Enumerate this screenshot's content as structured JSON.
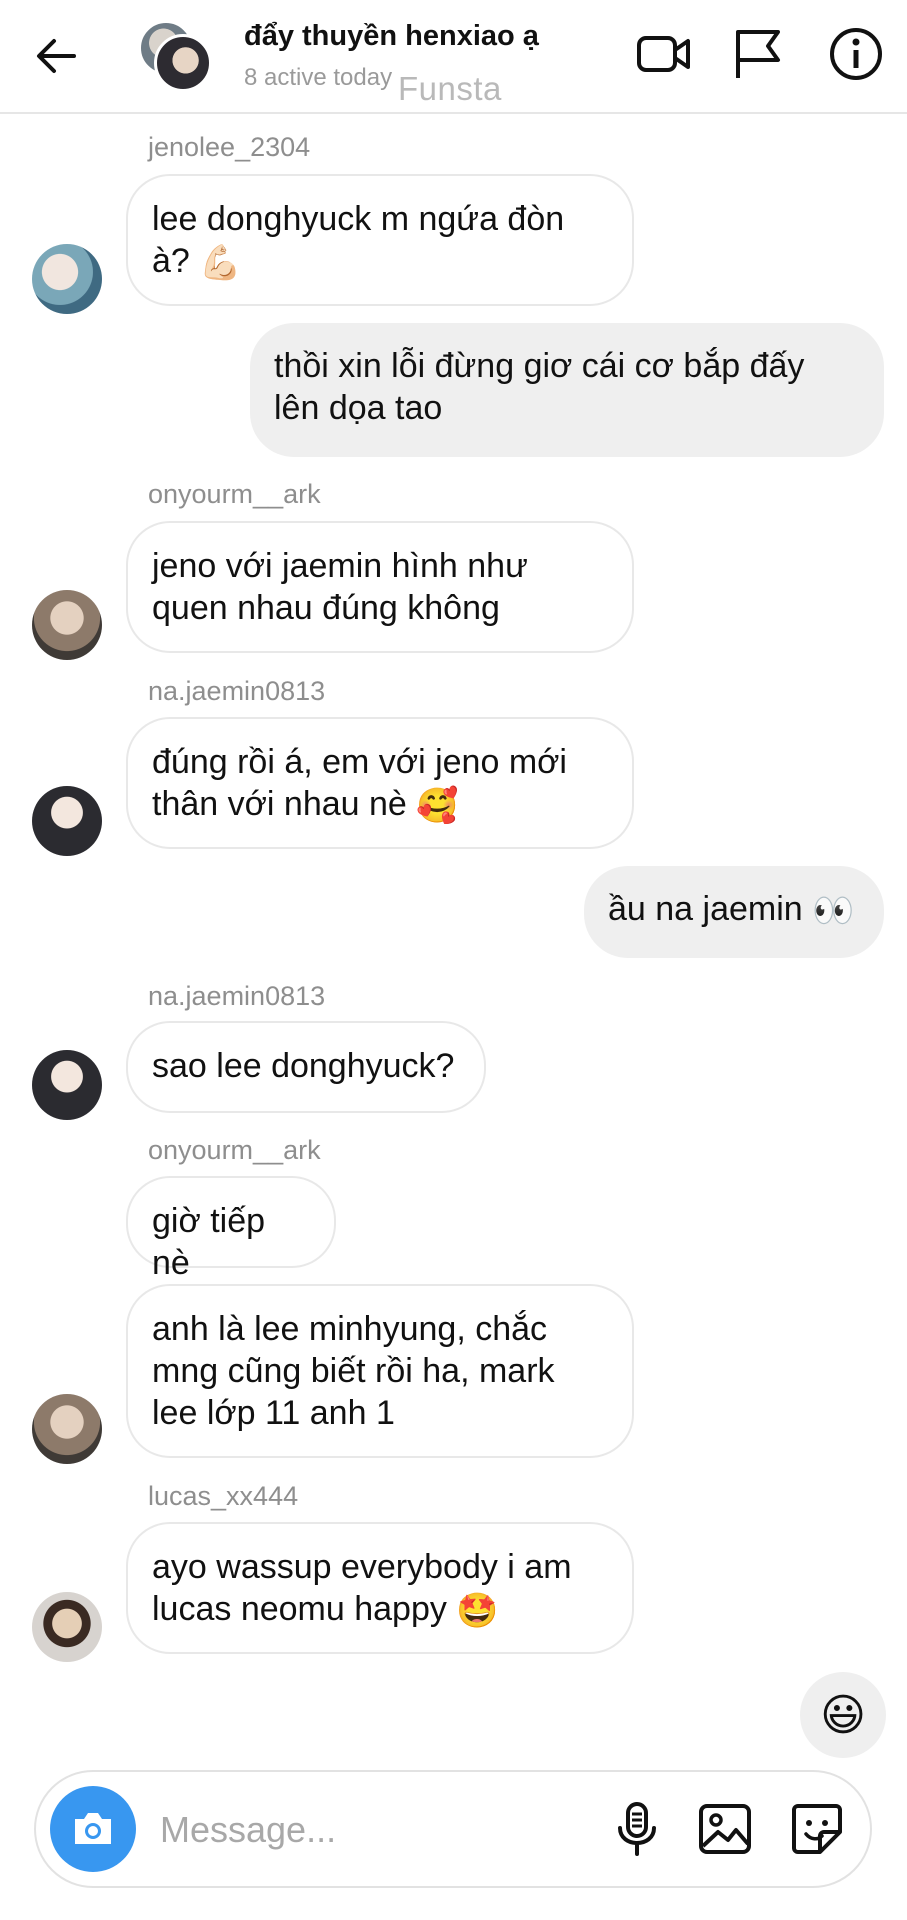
{
  "header": {
    "title": "đẩy thuyền henxiao ạ",
    "subtitle": "8 active today",
    "watermark": "Funsta",
    "icons": [
      "back-arrow-icon",
      "video-camera-icon",
      "flag-icon",
      "info-icon"
    ]
  },
  "messages": [
    {
      "sender": "jenolee_2304",
      "lines": [
        "lee donghyuck m ngứa đòn",
        "à?"
      ],
      "emoji": "💪🏻",
      "direction": "in"
    },
    {
      "lines": [
        "thồi xin lỗi đừng giơ cái cơ bắp đấy",
        "lên dọa tao"
      ],
      "direction": "out"
    },
    {
      "sender": "onyourm__ark",
      "lines": [
        "jeno với jaemin hình như",
        "quen nhau đúng không"
      ],
      "direction": "in"
    },
    {
      "sender": "na.jaemin0813",
      "lines": [
        "đúng rồi á, em với jeno mới",
        "thân với nhau nè"
      ],
      "emoji": "🥰",
      "direction": "in"
    },
    {
      "lines": [
        "ầu na jaemin"
      ],
      "emoji": "👀",
      "direction": "out"
    },
    {
      "sender": "na.jaemin0813",
      "lines": [
        "sao lee donghyuck?"
      ],
      "direction": "in"
    },
    {
      "sender": "onyourm__ark",
      "lines": [
        "giờ tiếp nè"
      ],
      "direction": "in"
    },
    {
      "lines": [
        "anh là lee minhyung, chắc",
        "mng cũng biết rồi ha, mark",
        "lee lớp 11 anh 1"
      ],
      "direction": "in"
    },
    {
      "sender": "lucas_xx444",
      "lines": [
        "ayo wassup everybody i am",
        "lucas neomu happy"
      ],
      "emoji": "🤩",
      "direction": "in"
    }
  ],
  "reaction_emoji": "😃",
  "composer": {
    "placeholder": "Message...",
    "icons": [
      "camera-icon",
      "microphone-icon",
      "gallery-icon",
      "sticker-icon"
    ]
  },
  "colors": {
    "accent": "#3897f0",
    "outgoing_bubble": "#efefef",
    "incoming_border": "#e8e8e8",
    "muted_text": "#8e8e8e"
  }
}
